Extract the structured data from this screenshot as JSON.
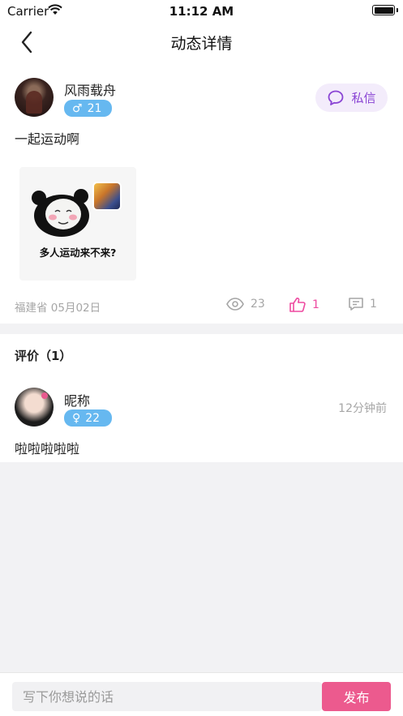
{
  "status_bar": {
    "carrier": "Carrier",
    "time": "11:12 AM"
  },
  "nav": {
    "title": "动态详情",
    "back_icon": "chevron-left-icon"
  },
  "post": {
    "author": {
      "name": "风雨载舟",
      "gender_symbol": "♂",
      "age": "21"
    },
    "dm_label": "私信",
    "text": "一起运动啊",
    "image_caption": "多人运动来不来?",
    "location_date": "福建省 05月02日",
    "views": "23",
    "likes": "1",
    "comments": "1"
  },
  "comments_section": {
    "header": "评价（1）",
    "items": [
      {
        "name": "昵称",
        "gender_symbol": "♀",
        "age": "22",
        "time": "12分钟前",
        "text": "啦啦啦啦啦"
      }
    ]
  },
  "bottom_bar": {
    "placeholder": "写下你想说的话",
    "publish_label": "发布"
  },
  "colors": {
    "accent_pink": "#ec5a8e",
    "like_pink": "#ee4aa0",
    "badge_blue": "#66b8f0",
    "dm_purple": "#8a45d4"
  }
}
